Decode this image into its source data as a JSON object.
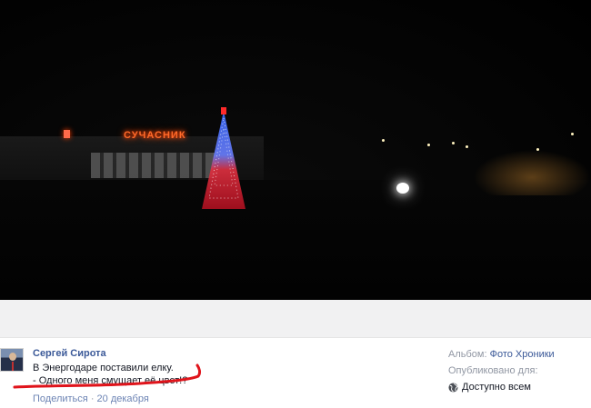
{
  "photo": {
    "sign_text": "СУЧАСНИК"
  },
  "post": {
    "author": "Сергей Сирота",
    "caption_line1": "В Энергодаре поставили елку.",
    "caption_line2": "- Одного меня смущает её цвет!?",
    "share_label": "Поделиться",
    "separator": "·",
    "date": "20 декабря"
  },
  "sidebar": {
    "album_label": "Альбом:",
    "album_name": "Фото Хроники",
    "published_for_label": "Опубликовано для:",
    "privacy_label": "Доступно всем",
    "privacy_icon": "globe-icon"
  },
  "colors": {
    "link": "#3b5998",
    "annotation": "#e0141b"
  }
}
